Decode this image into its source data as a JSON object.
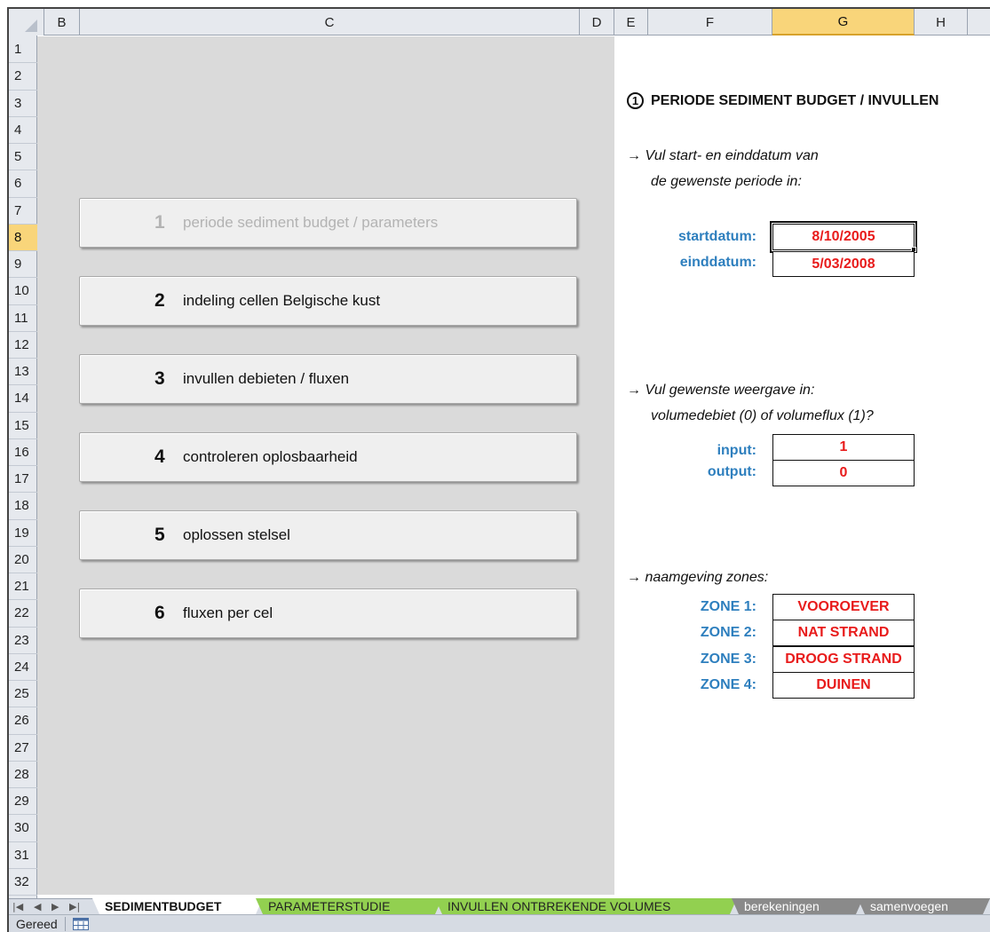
{
  "columns": [
    "B",
    "C",
    "D",
    "E",
    "F",
    "G",
    "H"
  ],
  "selected_column": "G",
  "rows": [
    "1",
    "2",
    "3",
    "4",
    "5",
    "6",
    "7",
    "8",
    "9",
    "10",
    "11",
    "12",
    "13",
    "14",
    "15",
    "16",
    "17",
    "18",
    "19",
    "20",
    "21",
    "22",
    "23",
    "24",
    "25",
    "26",
    "27",
    "28",
    "29",
    "30",
    "31",
    "32"
  ],
  "selected_row": "8",
  "nav_buttons": [
    {
      "num": "1",
      "label": "periode sediment budget / parameters",
      "disabled": true
    },
    {
      "num": "2",
      "label": "indeling cellen Belgische kust"
    },
    {
      "num": "3",
      "label": "invullen debieten / fluxen"
    },
    {
      "num": "4",
      "label": "controleren oplosbaarheid"
    },
    {
      "num": "5",
      "label": "oplossen stelsel"
    },
    {
      "num": "6",
      "label": "fluxen per cel"
    }
  ],
  "heading": {
    "circle": "1",
    "text": "PERIODE SEDIMENT BUDGET / INVULLEN"
  },
  "period": {
    "instruction_line1": "→  Vul start- en einddatum van",
    "instruction_line2": "de gewenste periode in:",
    "start_label": "startdatum:",
    "start_value": "8/10/2005",
    "end_label": "einddatum:",
    "end_value": "5/03/2008"
  },
  "display": {
    "instruction_line1": "→  Vul gewenste weergave in:",
    "instruction_line2": "volumedebiet (0) of volumeflux (1)?",
    "input_label": "input:",
    "input_value": "1",
    "output_label": "output:",
    "output_value": "0"
  },
  "zones": {
    "instruction": "→  naamgeving zones:",
    "items": [
      {
        "label": "ZONE 1:",
        "value": "VOOROEVER"
      },
      {
        "label": "ZONE 2:",
        "value": "NAT STRAND"
      },
      {
        "label": "ZONE 3:",
        "value": "DROOG STRAND"
      },
      {
        "label": "ZONE 4:",
        "value": "DUINEN"
      }
    ]
  },
  "sheet_tabs": [
    {
      "label": "SEDIMENTBUDGET",
      "style": "active"
    },
    {
      "label": "PARAMETERSTUDIE",
      "style": "green"
    },
    {
      "label": "INVULLEN ONTBREKENDE VOLUMES",
      "style": "green"
    },
    {
      "label": "berekeningen",
      "style": "gray"
    },
    {
      "label": "samenvoegen",
      "style": "gray"
    }
  ],
  "tab_nav": [
    "|◀",
    "◀",
    "▶",
    "▶|"
  ],
  "status": {
    "text": "Gereed",
    "icon": "sheet-view-icon"
  },
  "colors": {
    "accent_blue": "#2e7fbe",
    "value_red": "#e81b1b",
    "tab_green": "#92d050",
    "selected_header": "#f9d57a"
  }
}
